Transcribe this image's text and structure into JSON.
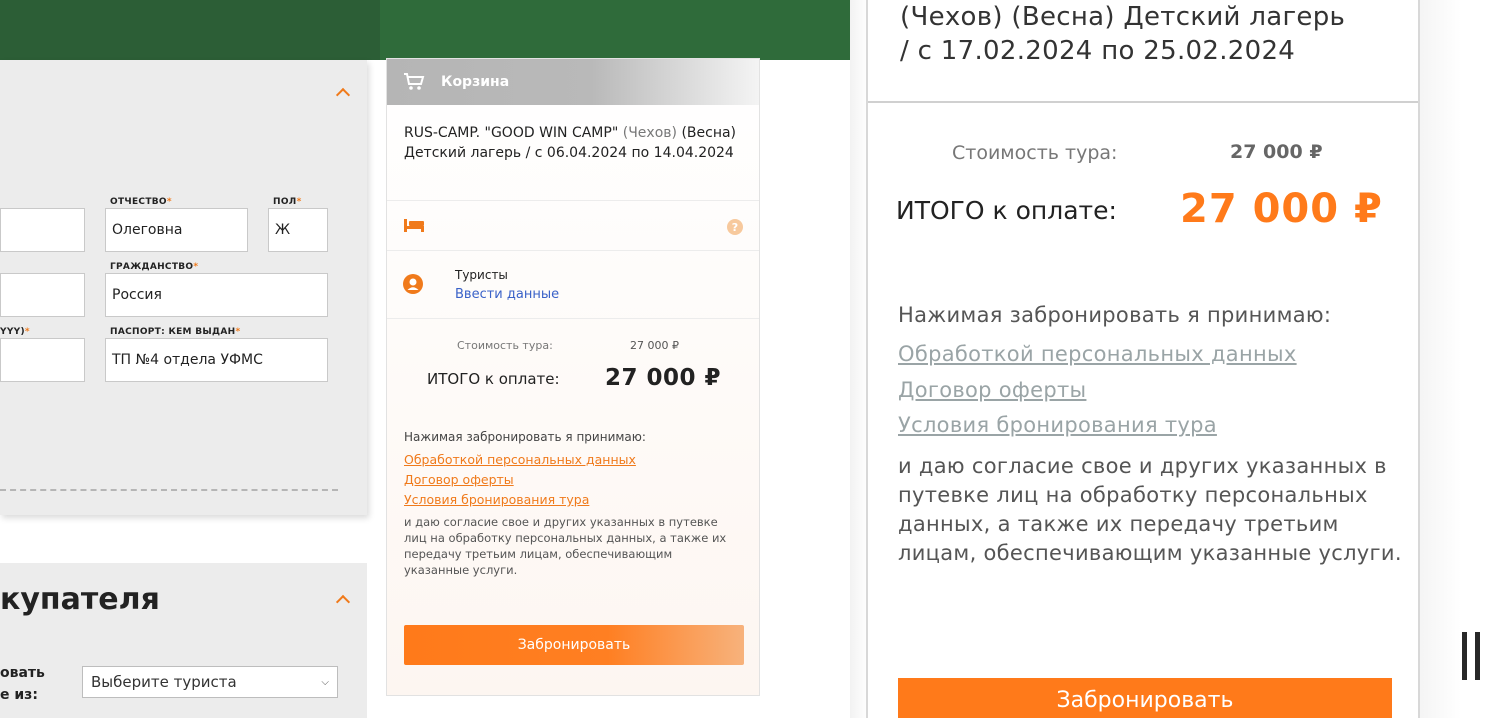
{
  "form": {
    "patronymic_label": "ОТЧЕСТВО",
    "patronymic_value": "Олеговна",
    "gender_label": "ПОЛ",
    "gender_value": "Ж",
    "citizenship_label": "ГРАЖДАНСТВО",
    "citizenship_value": "Россия",
    "date_label_fragment": "YYY)",
    "passport_label": "ПАСПОРТ: КЕМ ВЫДАН",
    "passport_value": "ТП №4 отдела УФМС",
    "required_mark": "*"
  },
  "buyer": {
    "title_fragment": "купателя",
    "label_line1": "овать",
    "label_line2": "е из:",
    "select_value": "Выберите туриста"
  },
  "cart": {
    "header": "Корзина",
    "tour_main": "RUS-CAMP. \"GOOD WIN CAMP\"",
    "tour_place": "(Чехов)",
    "tour_rest": "(Весна) Детский лагерь / с 06.04.2024 по 14.04.2024",
    "help_glyph": "?",
    "tourists_label": "Туристы",
    "tourists_link": "Ввести данные",
    "cost_label": "Стоимость тура:",
    "cost_value": "27 000 ₽",
    "total_label": "ИТОГО к оплате:",
    "total_value": "27 000 ₽",
    "agree_intro": "Нажимая забронировать я принимаю:",
    "links": [
      "Обработкой персональных данных",
      "Договор оферты",
      "Условия бронирования тура"
    ],
    "agree_text": "и даю согласие свое и других указанных в путевке лиц на обработку персональных данных, а также их передачу третьим лицам, обеспечивающим указанные услуги.",
    "book_button": "Забронировать"
  },
  "zoom": {
    "tour_line1": "(Чехов) (Весна) Детский лагерь",
    "tour_line2": "/ с 17.02.2024 по 25.02.2024",
    "cost_label": "Стоимость тура:",
    "cost_value": "27 000 ₽",
    "total_label": "ИТОГО к оплате:",
    "total_value": "27 000 ₽",
    "agree_intro": "Нажимая забронировать я принимаю:",
    "links": [
      "Обработкой персональных данных",
      "Договор оферты",
      "Условия бронирования тура"
    ],
    "agree_text": "и даю согласие свое и других указанных в путевке лиц на обработку персональных данных, а также их передачу третьим лицам, обеспечивающим указанные услуги.",
    "book_button": "Забронировать"
  },
  "colors": {
    "accent": "#f07a1b",
    "link_blue": "#3a62c8",
    "cart_header_gray": "#b5b5b5"
  },
  "icons": [
    "chevron-up-icon",
    "cart-icon",
    "bed-icon",
    "help-icon",
    "user-icon",
    "chevron-down-icon"
  ]
}
